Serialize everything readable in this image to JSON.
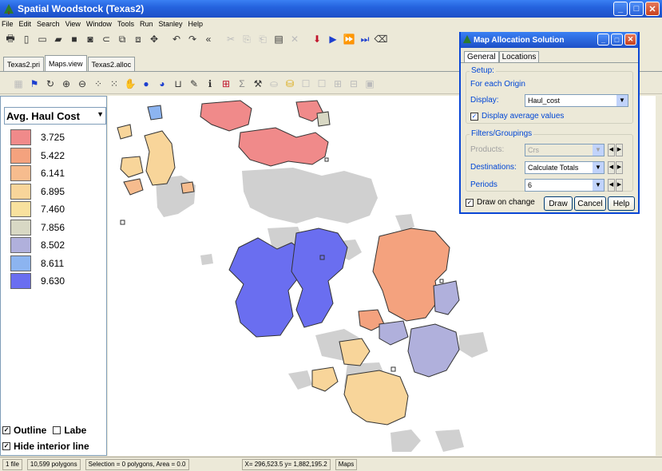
{
  "window": {
    "title": "Spatial Woodstock (Texas2)",
    "buttons": {
      "minimize": "_",
      "maximize": "□",
      "close": "✕"
    }
  },
  "menu": [
    "File",
    "Edit",
    "Search",
    "View",
    "Window",
    "Tools",
    "Run",
    "Stanley",
    "Help"
  ],
  "tabs": [
    "Texas2.pri",
    "Maps.view",
    "Texas2.alloc"
  ],
  "legend": {
    "selected": "Avg. Haul Cost",
    "items": [
      {
        "value": "3.725",
        "color": "#f08a8a"
      },
      {
        "value": "5.422",
        "color": "#f4a27e"
      },
      {
        "value": "6.141",
        "color": "#f6bc8e"
      },
      {
        "value": "6.895",
        "color": "#f8d59a"
      },
      {
        "value": "7.460",
        "color": "#f8e19e"
      },
      {
        "value": "7.856",
        "color": "#d8d8c4"
      },
      {
        "value": "8.502",
        "color": "#b0b0dc"
      },
      {
        "value": "8.611",
        "color": "#8cb4f0"
      },
      {
        "value": "9.630",
        "color": "#6a6ef0"
      }
    ],
    "outline_label": "Outline",
    "label_label": "Labe",
    "hide_label": "Hide interior line"
  },
  "status": {
    "files": "1 file",
    "polygons": "10,599 polygons",
    "selection": "Selection = 0 polygons, Area = 0.0",
    "coords": "X= 296,523.5 y= 1,882,195.2",
    "mode": "Maps"
  },
  "dialog": {
    "title": "Map Allocation Solution",
    "tabs": [
      "General",
      "Locations"
    ],
    "setup_title": "Setup:",
    "for_each": "For each Origin",
    "display_label": "Display:",
    "display_value": "Haul_cost",
    "avg_label": "Display average values",
    "filters_title": "Filters/Groupings",
    "products_label": "Products:",
    "products_value": "Crs",
    "destinations_label": "Destinations:",
    "destinations_value": "Calculate Totals",
    "periods_label": "Periods",
    "periods_value": "6",
    "draw_on_change": "Draw on change",
    "draw_btn": "Draw",
    "cancel_btn": "Cancel",
    "help_btn": "Help"
  }
}
